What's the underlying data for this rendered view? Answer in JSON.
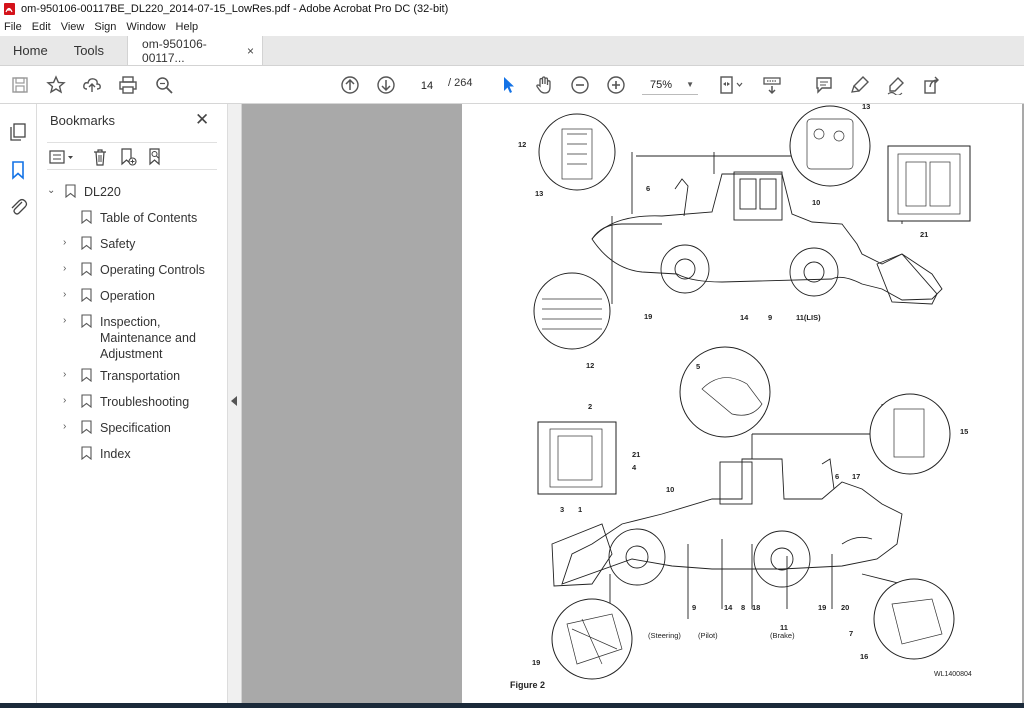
{
  "window": {
    "title": "om-950106-00117BE_DL220_2014-07-15_LowRes.pdf - Adobe Acrobat Pro DC (32-bit)"
  },
  "menu": [
    "File",
    "Edit",
    "View",
    "Sign",
    "Window",
    "Help"
  ],
  "tabs": {
    "home": "Home",
    "tools": "Tools",
    "doc": "om-950106-00117...",
    "close": "×"
  },
  "toolbar": {
    "page_current": "14",
    "page_total": "/ 264",
    "zoom": "75%",
    "icons": [
      "save-icon",
      "star-icon",
      "upload-icon",
      "print-icon",
      "search-icon",
      "page-up-icon",
      "page-down-icon",
      "select-cursor-icon",
      "hand-icon",
      "zoom-out-icon",
      "zoom-in-icon",
      "fit-page-icon",
      "keyboard-icon",
      "comment-icon",
      "highlight-icon",
      "sign-icon",
      "share-icon"
    ]
  },
  "bookmarks": {
    "title": "Bookmarks",
    "close": "✕",
    "root": "DL220",
    "items": [
      {
        "label": "Table of Contents",
        "expandable": false
      },
      {
        "label": "Safety",
        "expandable": true
      },
      {
        "label": "Operating Controls",
        "expandable": true
      },
      {
        "label": "Operation",
        "expandable": true
      },
      {
        "label": "Inspection, Maintenance and Adjustment",
        "lines": [
          "Inspection,",
          "Maintenance and",
          "Adjustment"
        ],
        "expandable": true
      },
      {
        "label": "Transportation",
        "expandable": true
      },
      {
        "label": "Troubleshooting",
        "expandable": true
      },
      {
        "label": "Specification",
        "expandable": true
      },
      {
        "label": "Index",
        "expandable": false
      }
    ]
  },
  "document": {
    "figure_label": "Figure 2",
    "figure_id": "WL1400804",
    "callouts_top": [
      "12",
      "13",
      "6",
      "13",
      "10",
      "21",
      "19",
      "14",
      "9",
      "11(LIS)",
      "12"
    ],
    "callouts_bottom": [
      "5",
      "2",
      "15",
      "21",
      "4",
      "6",
      "17",
      "10",
      "3",
      "1",
      "9",
      "14",
      "8",
      "18",
      "11",
      "19",
      "20",
      "(Steering)",
      "(Pilot)",
      "(Brake)",
      "7",
      "16",
      "19"
    ]
  }
}
